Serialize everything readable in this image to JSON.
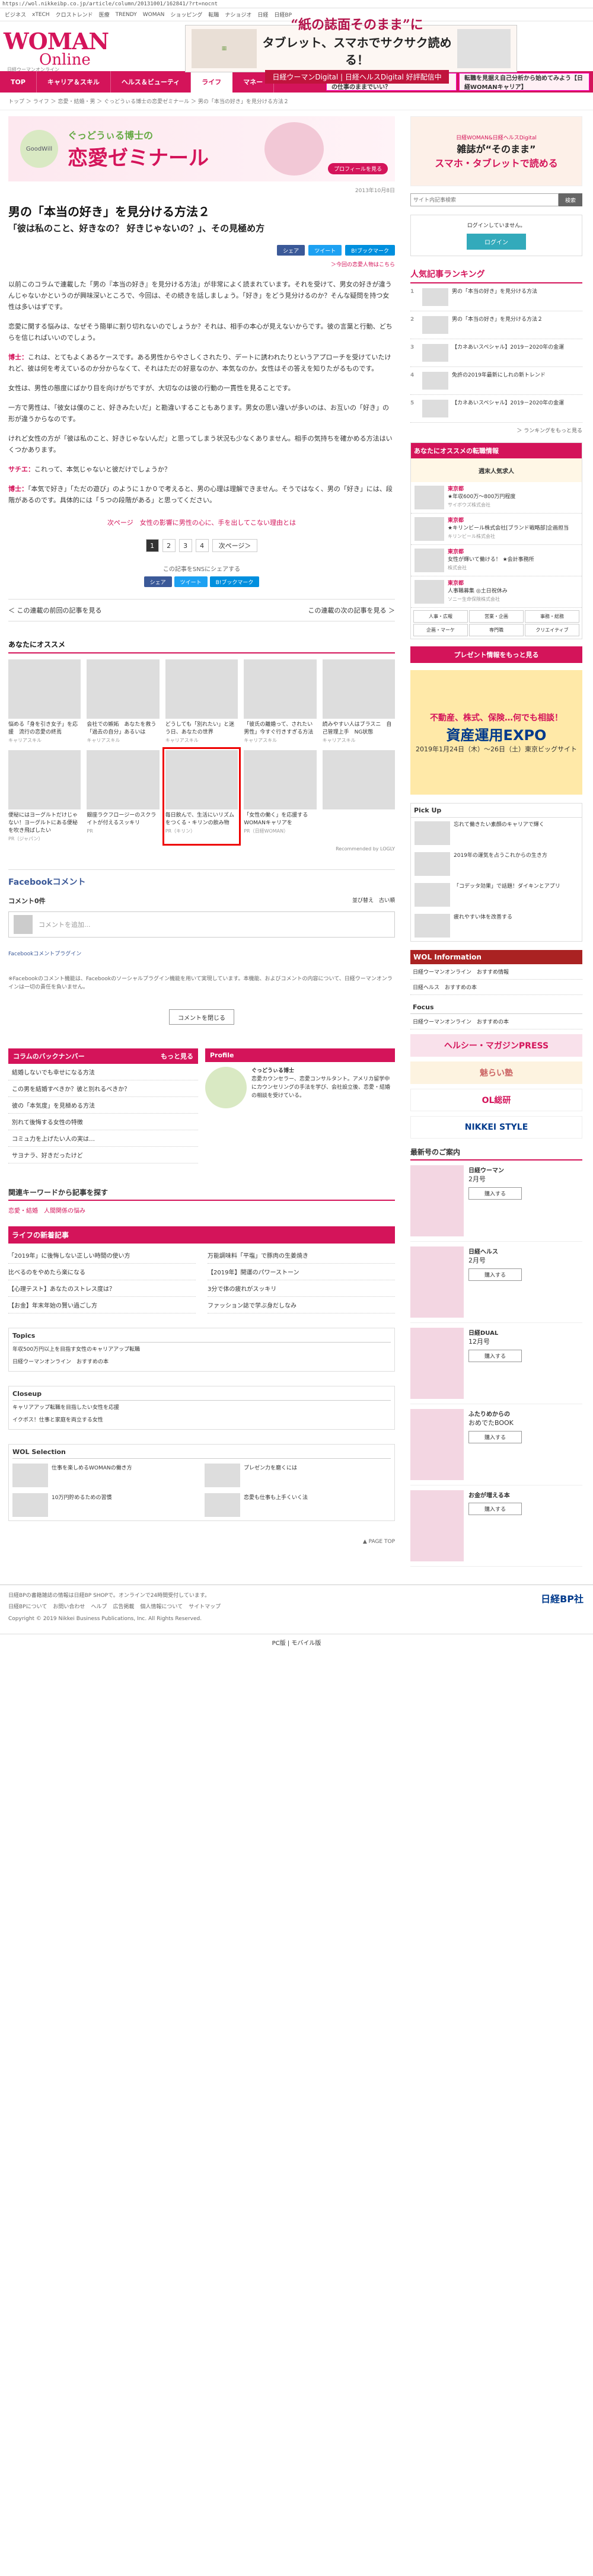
{
  "url": "https://wol.nikkeibp.co.jp/article/column/20131001/162841/?rt=nocnt",
  "topnav": [
    "ビジネス",
    "xTECH",
    "クロストレンド",
    "医療",
    "TRENDY",
    "WOMAN",
    "ショッピング",
    "転職",
    "ナショジオ",
    "日経",
    "日経BP"
  ],
  "header": {
    "logo_top": "WOMAN",
    "logo_bottom": "Online",
    "logo_sub": "日経ウーマンオンライン",
    "ad_line1": "“紙の誌面そのまま”に",
    "ad_line2": "タブレット、スマホでサクサク読める！",
    "ad_btn": "日経ウーマンDigital | 日経ヘルスDigital 好評配信中"
  },
  "nav": {
    "items": [
      "TOP",
      "キャリア＆スキル",
      "ヘルス＆ビューティ",
      "ライフ",
      "マネー"
    ],
    "active": "ライフ",
    "ad1": "「ずっと働き続けたい」「昇進したい」…今の仕事のままでいい？",
    "ad2": "転職を見据え自己分析から始めてみよう【日経WOMANキャリア】"
  },
  "breadcrumb": "トップ ＞ ライフ ＞ 恋愛・結婚・男 ＞ ぐっどうぃる博士の恋愛ゼミナール ＞ 男の「本当の好き」を見分ける方法２",
  "banner": {
    "line1": "ぐっどうぃる博士の",
    "line2": "恋愛ゼミナール",
    "badge": "GoodWill",
    "profile": "プロフィールを見る"
  },
  "article": {
    "date": "2013年10月8日",
    "title": "男の「本当の好き」を見分ける方法２",
    "subtitle": "「彼は私のこと、好きなの？ 好きじゃないの？」、その見極め方",
    "sns": [
      "シェア",
      "ツイート",
      "B!ブックマーク"
    ],
    "link_right": "＞今回の恋愛人物はこちら",
    "p1": "以前このコラムで連載した「男の『本当の好き』を見分ける方法」が非常によく読まれています。それを受けて、男女の好きが違うんじゃないかというのが興味深いところで、今回は、その続きを話しましょう。「好き」をどう見分けるのか？そんな疑問を持つ女性は多いはずです。",
    "p2": "恋愛に関する悩みは、なぜそう簡単に割り切れないのでしょうか？それは、相手の本心が見えないからです。彼の言葉と行動、どちらを信じればいいのでしょう。",
    "p3_name": "博士：",
    "p3": "これは、とてもよくあるケースです。ある男性からやさしくされたり、デートに誘われたりというアプローチを受けていたけれど、彼は何を考えているのか分からなくて、それはただの好意なのか、本気なのか。女性はその答えを知りたがるものです。",
    "p4": "女性は、男性の態度にばかり目を向けがちですが、大切なのは彼の行動の一貫性を見ることです。",
    "p5": "一方で男性は、「彼女は僕のこと、好きみたいだ」と勘違いすることもあります。男女の思い違いが多いのは、お互いの「好き」の形が違うからなのです。",
    "p6": "けれど女性の方が「彼は私のこと、好きじゃないんだ」と思ってしまう状況も少なくありません。相手の気持ちを確かめる方法はいくつかあります。",
    "p7_name": "サチエ：",
    "p7": "これって、本気じゃないと彼だけでしょうか？",
    "p8_name": "博士：",
    "p8": "「本気で好き」「ただの遊び」のように１か０で考えると、男の心理は理解できません。そうではなく、男の「好き」には、段階があるのです。具体的には「５つの段階がある」と思ってください。"
  },
  "next_link": "次ページ　女性の影響に男性の心に、手を出してこない理由とは",
  "pager": [
    "1",
    "2",
    "3",
    "4",
    "次ページ＞"
  ],
  "share_label": "この記事をSNSにシェアする",
  "share_btns": [
    "シェア",
    "ツイート",
    "B!ブックマーク"
  ],
  "prevnext": {
    "prev": "＜ この連載の前回の記事を見る",
    "next": "この連載の次の記事を見る ＞"
  },
  "recommend": {
    "title": "あなたにオススメ",
    "items": [
      {
        "t": "悩める「身を引き女子」を応援　流行の恋愛の終焉",
        "s": "キャリアスキル"
      },
      {
        "t": "会社での嫉妬　あなたを救う「過去の自分」あるいは",
        "s": "キャリアスキル"
      },
      {
        "t": "どうしても「別れたい」と迷う日、あなたの世界",
        "s": "キャリアスキル"
      },
      {
        "t": "「彼氏の離婚って、されたい男性」今すぐ行きすぎる方法",
        "s": "キャリアスキル"
      },
      {
        "t": "読みやすい人はブラスニ　自己管理上手　NG状態",
        "s": "キャリアスキル"
      },
      {
        "t": "便秘にはヨーグルトだけじゃない！ヨーグルトにある便秘を吹き飛ばしたい",
        "s": "PR（ジャパン）"
      },
      {
        "t": "銀座ラクフロージーのスクライトが付えるスッキリ",
        "s": "PR"
      },
      {
        "t": "毎日飲んで、生活にいリズムをつくる・キリンの飲み物",
        "s": "PR（キリン）"
      },
      {
        "t": "「女性の働く」を応援するWOMANキャリアを",
        "s": "PR（日経WOMAN）"
      },
      {
        "t": "",
        "s": ""
      }
    ],
    "by": "Recommended by  LOGLY"
  },
  "fb": {
    "title": "Facebookコメント",
    "count": "コメント0件",
    "sort": "並び替え　古い順",
    "placeholder": "コメントを追加...",
    "plugin": "Facebookコメントプラグイン",
    "note": "※Facebookのコメント機能は、Facebookのソーシャルプラグイン機能を用いて実現しています。本機能、およびコメントの内容について、日経ウーマンオンラインは一切の責任を負いません。",
    "close": "コメントを閉じる"
  },
  "backnumber": {
    "title": "コラムのバックナンバー",
    "more": "もっと見る",
    "items": [
      "結婚しないでも幸せになる方法",
      "この男を結婚すべきか？彼と別れるべきか？",
      "彼の「本気度」を見極める方法",
      "別れて後悔する女性の特徴",
      "コミュ力を上げたい人の実は…",
      "サヨナラ、好きだったけど"
    ]
  },
  "profile": {
    "title": "Profile",
    "name": "ぐっどうぃる博士",
    "body": "恋愛カウンセラー、恋愛コンサルタント。アメリカ留学中にカウンセリングの手法を学び、会社設立後、恋愛・結婚の相談を受けている。"
  },
  "keyword": {
    "title": "関連キーワードから記事を探す",
    "links": "恋愛・結婚　人間関係の悩み"
  },
  "newlist": {
    "title": "ライフの新着記事",
    "items": [
      "「2019年」に後悔しない正しい時間の使い方",
      "万能調味料「平塩」で豚肉の生姜焼き",
      "比べるのをやめたら楽になる",
      "【2019年】開運のパワーストーン",
      "【心理テスト】あなたのストレス度は？",
      "3分で体の疲れがスッキリ",
      "【お金】年末年始の賢い過ごし方",
      "ファッション誌で学ぶ身だしなみ"
    ]
  },
  "topics": {
    "title": "Topics",
    "items": [
      "年収500万円以上を目指す女性のキャリアアップ転職",
      "日経ウーマンオンライン　おすすめの本"
    ]
  },
  "closeup": {
    "title": "Closeup",
    "items": [
      "キャリアアップ転職を目指したい女性を応援",
      "イクボス！仕事と家庭を両立する女性"
    ]
  },
  "wol": {
    "title": "WOL Selection",
    "items": [
      "仕事を楽しめるWOMANの働き方",
      "プレゼン力を磨くには",
      "10万円貯めるための習慣",
      "恋愛も仕事も上手くいく法"
    ]
  },
  "pagetop": "▲ PAGE TOP",
  "footer": {
    "note": "日経BPの書籍雑誌の情報は日経BP SHOPで。オンラインで24時間受付しています。",
    "links": [
      "日経BPについて",
      "お問い合わせ",
      "ヘルプ",
      "広告掲載",
      "個人情報について",
      "サイトマップ"
    ],
    "copy": "Copyright © 2019 Nikkei Business Publications, Inc. All Rights Reserved.",
    "brand": "日経BP社",
    "pcmb": "PC版 | モバイル版"
  },
  "side": {
    "ad_a": "日経WOMAN&日経ヘルスDigital",
    "ad_b": "雑誌が“そのまま”",
    "ad_c": "スマホ・タブレットで読める",
    "search_placeholder": "サイト内記事検索",
    "search_btn": "検索",
    "login_text": "ログインしていません。",
    "login_btn": "ログイン",
    "rank_title": "人気記事ランキング",
    "rank": [
      {
        "n": "1",
        "t": "男の「本当の好き」を見分ける方法"
      },
      {
        "n": "2",
        "t": "男の「本当の好き」を見分ける方法２"
      },
      {
        "n": "3",
        "t": "【カネあいスペシャル】2019－2020年の金運"
      },
      {
        "n": "4",
        "t": "免許の2019年最新にしれの新トレンド"
      },
      {
        "n": "5",
        "t": "【カネあいスペシャル】2019－2020年の金運"
      }
    ],
    "rank_more": "＞ ランキングをもっと見る",
    "job_title": "あなたにオススメの転職情報",
    "job_ad": "週末人気求人",
    "jobs": [
      {
        "c": "東京都",
        "t": "★年収600万～800万円程度",
        "co": "サイボウズ株式会社"
      },
      {
        "c": "東京都",
        "t": "★キリンビール株式会社[ブランド戦略部]企画担当",
        "co": "キリンビール株式会社"
      },
      {
        "c": "東京都",
        "t": "女性が輝いて働ける！ ★会計事務所",
        "co": "株式会社"
      },
      {
        "c": "東京都",
        "t": "人事職募集 ◎土日祝休み",
        "co": "ソニー生命保険株式会社"
      }
    ],
    "job_grid": [
      "人事・広報",
      "営業・企画",
      "事務・総務",
      "企画・マーケ",
      "専門職",
      "クリエイティブ"
    ],
    "present": "プレゼント情報をもっと見る",
    "expo_a": "不動産、株式、保険…何でも相談！",
    "expo_b": "資産運用EXPO",
    "expo_c": "2019年1月24日（木）～26日（土）東京ビッグサイト",
    "pick_title": "Pick Up",
    "pick": [
      "忘れて働きたい素顔のキャリアで輝く",
      "2019年の運気を占うこれからの生き方",
      "「コデッタ効果」で話題！ダイキンとアプリ",
      "疲れやすい体を改善する"
    ],
    "info_title": "WOL Information",
    "info": [
      "日経ウーマンオンライン　おすすめ情報",
      "日経ヘルス　おすすめの本"
    ],
    "focus_title": "Focus",
    "focus": [
      "日経ウーマンオンライン　おすすめの本"
    ],
    "ad1": "ヘルシー・マガジンPRESS",
    "ad2": "魅らい塾",
    "ad3": "OL総研",
    "ad4": "NIKKEI STYLE",
    "mag_title": "最新号のご案内",
    "mags": [
      {
        "t": "日経ウーマン",
        "s": "2月号",
        "btn": "購入する"
      },
      {
        "t": "日経ヘルス",
        "s": "2月号",
        "btn": "購入する"
      },
      {
        "t": "日経DUAL",
        "s": "12月号",
        "btn": "購入する"
      },
      {
        "t": "ふたりめからの",
        "s": "おめでたBOOK",
        "btn": "購入する"
      },
      {
        "t": "お金が増える本",
        "s": "",
        "btn": "購入する"
      }
    ]
  }
}
